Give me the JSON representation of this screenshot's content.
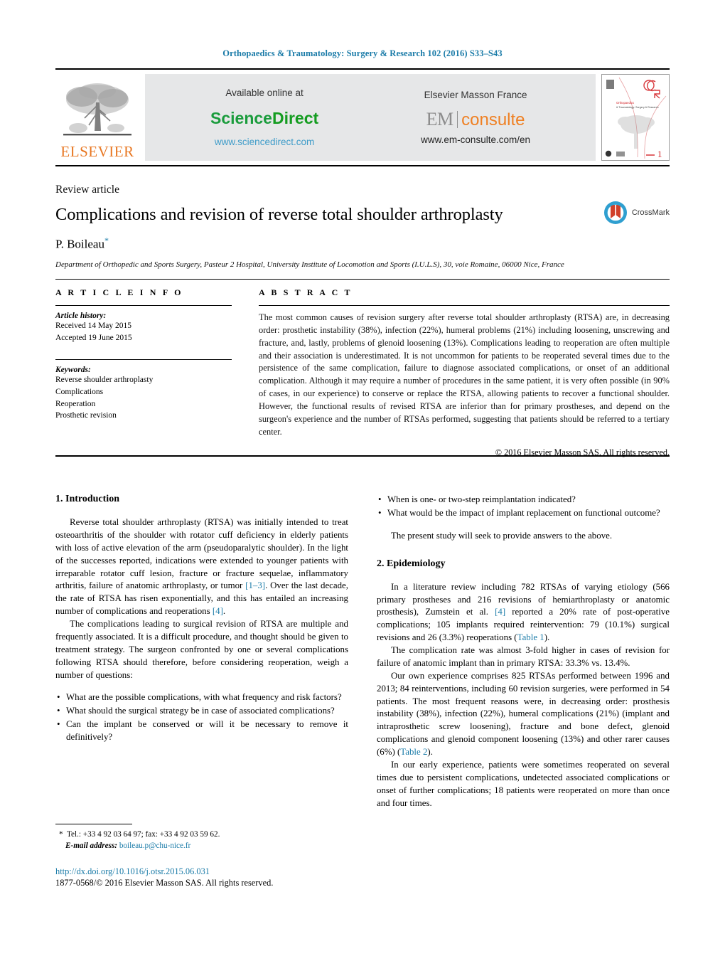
{
  "running_head": "Orthopaedics & Traumatology: Surgery & Research 102 (2016) S33–S43",
  "masthead": {
    "publisher_name": "ELSEVIER",
    "sciencedirect": {
      "available_label": "Available online at",
      "brand_science": "Science",
      "brand_direct": "Direct",
      "url": "www.sciencedirect.com"
    },
    "emconsulte": {
      "imprint_label": "Elsevier Masson France",
      "brand_em": "EM",
      "brand_consulte": "consulte",
      "url": "www.em-consulte.com/en"
    },
    "cover_thumb_alt": "journal-cover-thumbnail"
  },
  "title_block": {
    "article_type": "Review article",
    "title": "Complications and revision of reverse total shoulder arthroplasty",
    "author": "P. Boileau",
    "author_marker": "*",
    "affiliation": "Department of Orthopedic and Sports Surgery, Pasteur 2 Hospital, University Institute of Locomotion and Sports (I.U.L.S), 30, voie Romaine, 06000 Nice, France",
    "crossmark_label": "CrossMark"
  },
  "article_info": {
    "heading": "A R T I C L E   I N F O",
    "history_label": "Article history:",
    "history": [
      "Received 14 May 2015",
      "Accepted 19 June 2015"
    ],
    "keywords_label": "Keywords:",
    "keywords": [
      "Reverse shoulder arthroplasty",
      "Complications",
      "Reoperation",
      "Prosthetic revision"
    ]
  },
  "abstract": {
    "heading": "A B S T R A C T",
    "text": "The most common causes of revision surgery after reverse total shoulder arthroplasty (RTSA) are, in decreasing order: prosthetic instability (38%), infection (22%), humeral problems (21%) including loosening, unscrewing and fracture, and, lastly, problems of glenoid loosening (13%). Complications leading to reoperation are often multiple and their association is underestimated. It is not uncommon for patients to be reoperated several times due to the persistence of the same complication, failure to diagnose associated complications, or onset of an additional complication. Although it may require a number of procedures in the same patient, it is very often possible (in 90% of cases, in our experience) to conserve or replace the RTSA, allowing patients to recover a functional shoulder. However, the functional results of revised RTSA are inferior than for primary prostheses, and depend on the surgeon's experience and the number of RTSAs performed, suggesting that patients should be referred to a tertiary center.",
    "copyright": "© 2016 Elsevier Masson SAS. All rights reserved."
  },
  "body": {
    "section_1_heading": "1.  Introduction",
    "p1_a": "Reverse total shoulder arthroplasty (RTSA) was initially intended to treat osteoarthritis of the shoulder with rotator cuff deficiency in elderly patients with loss of active elevation of the arm (pseudoparalytic shoulder). In the light of the successes reported, indications were extended to younger patients with irreparable rotator cuff lesion, fracture or fracture sequelae, inflammatory arthritis, failure of anatomic arthroplasty, or tumor ",
    "p1_ref1": "[1–3]",
    "p1_b": ". Over the last decade, the rate of RTSA has risen exponentially, and this has entailed an increasing number of complications and reoperations ",
    "p1_ref2": "[4]",
    "p1_c": ".",
    "p2": "The complications leading to surgical revision of RTSA are multiple and frequently associated. It is a difficult procedure, and thought should be given to treatment strategy. The surgeon confronted by one or several complications following RTSA should therefore, before considering reoperation, weigh a number of questions:",
    "questions_left": [
      "What are the possible complications, with what frequency and risk factors?",
      "What should the surgical strategy be in case of associated complications?",
      "Can the implant be conserved or will it be necessary to remove it definitively?"
    ],
    "questions_right": [
      "When is one- or two-step reimplantation indicated?",
      "What would be the impact of implant replacement on functional outcome?"
    ],
    "p3": "The present study will seek to provide answers to the above.",
    "section_2_heading": "2.  Epidemiology",
    "p4_a": "In a literature review including 782 RTSAs of varying etiology (566 primary prostheses and 216 revisions of hemiarthroplasty or anatomic prosthesis), Zumstein et al. ",
    "p4_ref": "[4]",
    "p4_b": " reported a 20% rate of post-operative complications; 105 implants required reintervention: 79 (10.1%) surgical revisions and 26 (3.3%) reoperations (",
    "p4_table": "Table 1",
    "p4_c": ").",
    "p5": "The complication rate was almost 3-fold higher in cases of revision for failure of anatomic implant than in primary RTSA: 33.3% vs. 13.4%.",
    "p6_a": "Our own experience comprises 825 RTSAs performed between 1996 and 2013; 84 reinterventions, including 60 revision surgeries, were performed in 54 patients. The most frequent reasons were, in decreasing order: prosthesis instability (38%), infection (22%), humeral complications (21%) (implant and intraprosthetic screw loosening), fracture and bone defect, glenoid complications and glenoid component loosening (13%) and other rarer causes (6%) (",
    "p6_table": "Table 2",
    "p6_b": ").",
    "p7": "In our early experience, patients were sometimes reoperated on several times due to persistent complications, undetected associated complications or onset of further complications; 18 patients were reoperated on more than once and four times."
  },
  "footnote": {
    "marker": "*",
    "contact": "Tel.: +33 4 92 03 64 97; fax: +33 4 92 03 59 62.",
    "email_label": "E-mail address:",
    "email": "boileau.p@chu-nice.fr"
  },
  "doi": {
    "url": "http://dx.doi.org/10.1016/j.otsr.2015.06.031",
    "issn_copyright": "1877-0568/© 2016 Elsevier Masson SAS. All rights reserved."
  },
  "colors": {
    "journal_blue": "#1a7ba8",
    "elsevier_orange": "#E87722",
    "sciencedirect_green": "#149c20",
    "emconsulte_orange": "#ef8023",
    "banner_grey": "#e6e7e8"
  }
}
